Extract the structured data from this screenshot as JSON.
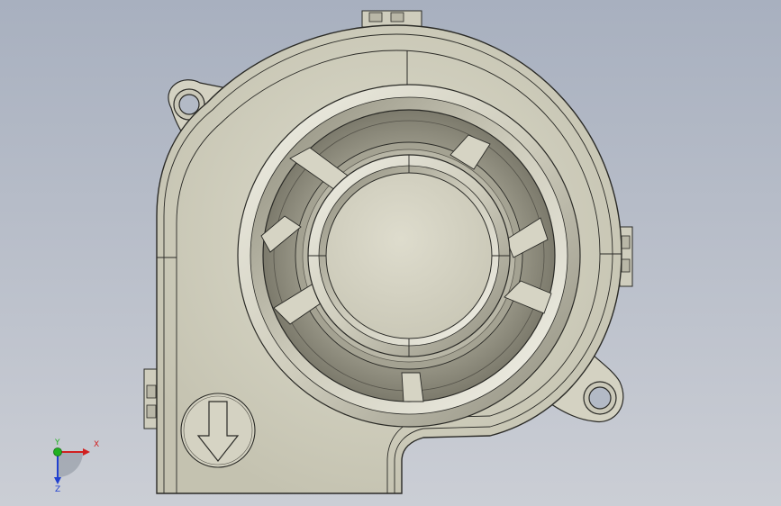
{
  "viewport": {
    "background_top": "#a9b1c0",
    "background_bottom": "#c9ccd3",
    "model_color": "#d6d4c4",
    "edge_color": "#2a2a26"
  },
  "model": {
    "name": "blower-fan",
    "features": [
      "housing",
      "mounting-tab-top-left",
      "mounting-tab-bottom-right",
      "inlet-ring",
      "hub",
      "spokes",
      "airflow-arrow-icon"
    ]
  },
  "triad": {
    "x_label": "X",
    "y_label": "Y",
    "z_label": "Z",
    "x_color": "#d12020",
    "y_color": "#20b020",
    "z_color": "#2040d0"
  }
}
